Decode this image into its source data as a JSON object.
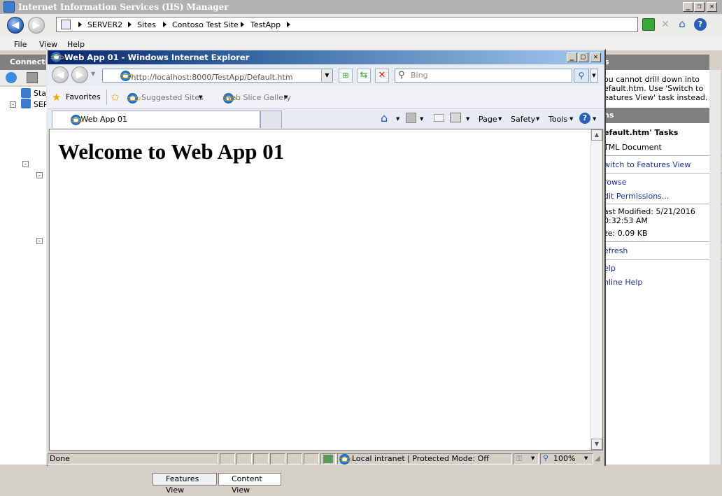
{
  "iis": {
    "title": "Internet Information Services (IIS) Manager",
    "breadcrumb": [
      "SERVER2",
      "Sites",
      "Contoso Test Site",
      "TestApp"
    ],
    "menu": [
      "File",
      "View",
      "Help"
    ],
    "connections_header": "Connectio",
    "tree_items": [
      "Sta",
      "SER"
    ],
    "actions_header_top": "s",
    "actions_message": [
      "ou cannot drill down into",
      "efault.htm. Use 'Switch to",
      "eatures View' task instead."
    ],
    "actions_header": "ns",
    "tasks_title": "efault.htm' Tasks",
    "doc_type": "TML Document",
    "switch_link": "witch to Features View",
    "browse_link": "rowse",
    "edit_permissions_link": "dit Permissions...",
    "last_modified_label": "ast Modified: 5/21/2016",
    "last_modified_time": "0:32:53 AM",
    "size_label": "ze: 0.09 KB",
    "refresh_link": "efresh",
    "help_link": "elp",
    "online_help_link": "nline Help",
    "bottom_tabs": [
      "Features View",
      "Content View"
    ]
  },
  "ie": {
    "title": "Web App 01 - Windows Internet Explorer",
    "url_host": "http://localhost",
    "url_rest": ":8000/TestApp/Default.htm",
    "search_placeholder": "Bing",
    "favorites_label": "Favorites",
    "suggested_sites": "Suggested Sites",
    "web_slice_gallery": "Web Slice Gallery",
    "tab_title": "Web App 01",
    "commands": [
      "Page",
      "Safety",
      "Tools"
    ],
    "heading": "Welcome to Web App 01",
    "status_done": "Done",
    "zone": "Local intranet | Protected Mode: Off",
    "zoom": "100%"
  }
}
